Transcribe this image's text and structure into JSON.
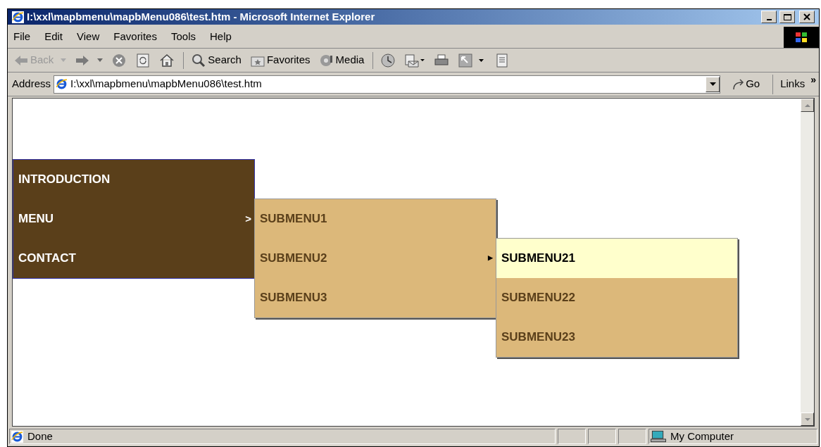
{
  "window": {
    "title": "I:\\xxl\\mapbmenu\\mapbMenu086\\test.htm - Microsoft Internet Explorer"
  },
  "menu_bar": [
    "File",
    "Edit",
    "View",
    "Favorites",
    "Tools",
    "Help"
  ],
  "toolbar": [
    {
      "kind": "back",
      "label": "Back",
      "disabled": true
    },
    {
      "kind": "forward",
      "disabled": false
    },
    {
      "kind": "stop"
    },
    {
      "kind": "refresh"
    },
    {
      "kind": "home"
    },
    {
      "kind": "search",
      "label": "Search"
    },
    {
      "kind": "favorites",
      "label": "Favorites"
    },
    {
      "kind": "media",
      "label": "Media"
    },
    {
      "kind": "history"
    },
    {
      "kind": "mail"
    },
    {
      "kind": "print"
    },
    {
      "kind": "edit"
    },
    {
      "kind": "discuss"
    }
  ],
  "address_bar": {
    "label": "Address",
    "value": "I:\\xxl\\mapbmenu\\mapbMenu086\\test.htm",
    "go": "Go",
    "links": "Links",
    "more": "»"
  },
  "page_menu": [
    {
      "label": "INTRODUCTION"
    },
    {
      "label": "MENU",
      "arrow": ">",
      "children": [
        {
          "label": "SUBMENU1"
        },
        {
          "label": "SUBMENU2",
          "arrow": "▶",
          "children": [
            {
              "label": "SUBMENU21",
              "selected": true
            },
            {
              "label": "SUBMENU22",
              "selected": false
            },
            {
              "label": "SUBMENU23",
              "selected": false
            }
          ]
        },
        {
          "label": "SUBMENU3"
        }
      ]
    },
    {
      "label": "CONTACT"
    }
  ],
  "status_bar": {
    "text": "Done",
    "zone": "My Computer"
  }
}
